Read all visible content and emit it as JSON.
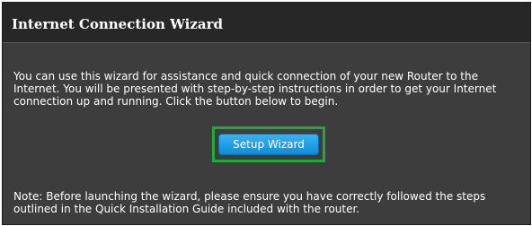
{
  "panel": {
    "title": "Internet Connection Wizard",
    "description": "You can use this wizard for assistance and quick connection of your new Router to the Internet. You will be presented with step-by-step instructions in order to get your Internet connection up and running. Click the button below to begin.",
    "wizard_button_label": "Setup Wizard",
    "note": "Note: Before launching the wizard, please ensure you have correctly followed the steps outlined in the Quick Installation Guide included with the router."
  },
  "colors": {
    "header_bg": "#272727",
    "panel_bg": "#3d3d3d",
    "button_blue": "#1a9ce3",
    "highlight_green": "#1fab3b",
    "text": "#ffffff"
  }
}
